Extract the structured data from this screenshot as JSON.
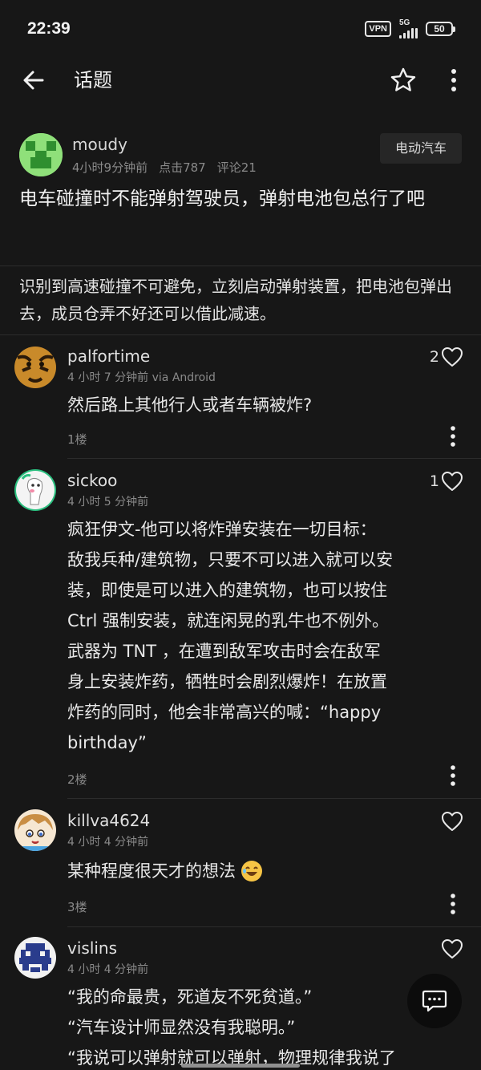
{
  "status_bar": {
    "time": "22:39",
    "vpn": "VPN",
    "network": "5G",
    "battery": "50"
  },
  "header": {
    "title": "话题"
  },
  "post": {
    "author": "moudy",
    "time": "4小时9分钟前",
    "views": "点击787",
    "comments": "评论21",
    "category": "电动汽车",
    "title": "电车碰撞时不能弹射驾驶员，弹射电池包总行了吧",
    "body": "识别到高速碰撞不可避免，立刻启动弹射装置，把电池包弹出去，成员仓弄不好还可以借此减速。"
  },
  "comments": [
    {
      "author": "palfortime",
      "meta": "4 小时 7 分钟前 via Android",
      "likes": "2",
      "text": "然后路上其他行人或者车辆被炸?",
      "floor": "1楼"
    },
    {
      "author": "sickoo",
      "meta": "4 小时 5 分钟前",
      "likes": "1",
      "lines": [
        "疯狂伊文-他可以将炸弹安装在一切目标：",
        "敌我兵种/建筑物，只要不可以进入就可以安",
        "装，即使是可以进入的建筑物，也可以按住",
        "Ctrl 强制安装，就连闲晃的乳牛也不例外。",
        "武器为 TNT ，在遭到敌军攻击时会在敌军",
        "身上安装炸药，牺牲时会剧烈爆炸！在放置",
        "炸药的同时，他会非常高兴的喊：“happy",
        "birthday”"
      ],
      "floor": "2楼"
    },
    {
      "author": "killva4624",
      "meta": "4 小时 4 分钟前",
      "likes": "",
      "text": "某种程度很天才的想法",
      "floor": "3楼"
    },
    {
      "author": "vislins",
      "meta": "4 小时 4 分钟前",
      "likes": "",
      "lines": [
        "“我的命最贵，死道友不死贫道。”",
        "“汽车设计师显然没有我聪明。”",
        "“我说可以弹射就可以弹射，物理规律我说了"
      ]
    }
  ],
  "colors": {
    "background": "#171717",
    "text": "#e8e8e8",
    "meta": "#8a8a8a"
  },
  "icons": [
    "back-arrow-icon",
    "star-icon",
    "more-vertical-icon",
    "heart-icon",
    "comment-icon"
  ]
}
